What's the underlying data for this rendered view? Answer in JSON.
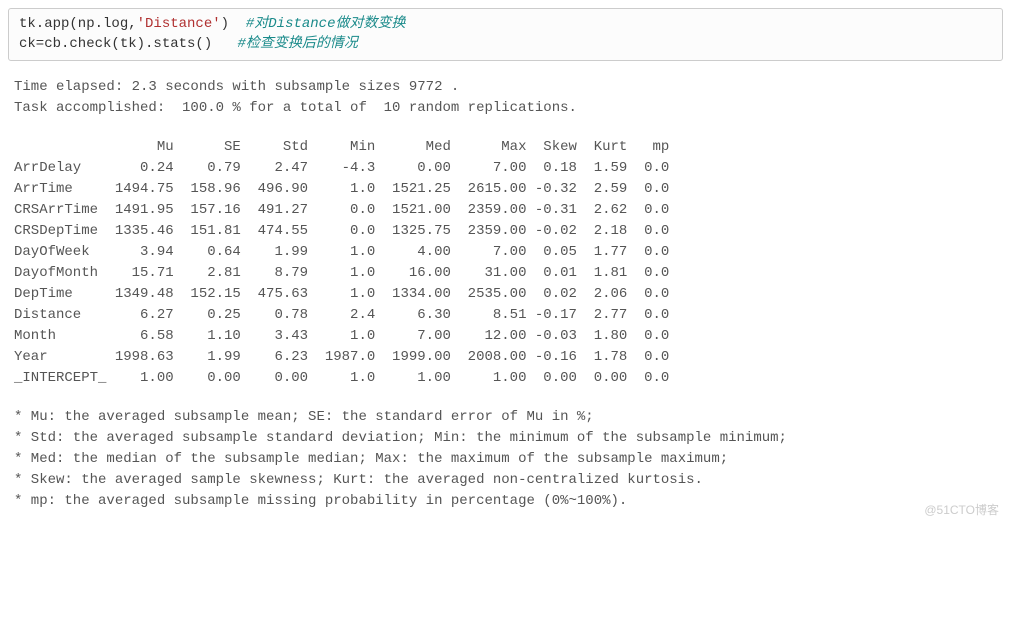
{
  "code": {
    "line1_pre": "tk.app(np.log,",
    "line1_str": "'Distance'",
    "line1_post": ")  ",
    "line1_comment": "#对Distance做对数变换",
    "line2_pre": "ck=cb.check(tk).stats()   ",
    "line2_comment": "#检查变换后的情况"
  },
  "output": {
    "line1": "Time elapsed: 2.3 seconds with subsample sizes 9772 .",
    "line2": "Task accomplished:  100.0 % for a total of  10 random replications."
  },
  "stats": {
    "header": "                 Mu      SE     Std     Min      Med      Max  Skew  Kurt   mp",
    "rows": [
      "ArrDelay       0.24    0.79    2.47    -4.3     0.00     7.00  0.18  1.59  0.0",
      "ArrTime     1494.75  158.96  496.90     1.0  1521.25  2615.00 -0.32  2.59  0.0",
      "CRSArrTime  1491.95  157.16  491.27     0.0  1521.00  2359.00 -0.31  2.62  0.0",
      "CRSDepTime  1335.46  151.81  474.55     0.0  1325.75  2359.00 -0.02  2.18  0.0",
      "DayOfWeek      3.94    0.64    1.99     1.0     4.00     7.00  0.05  1.77  0.0",
      "DayofMonth    15.71    2.81    8.79     1.0    16.00    31.00  0.01  1.81  0.0",
      "DepTime     1349.48  152.15  475.63     1.0  1334.00  2535.00  0.02  2.06  0.0",
      "Distance       6.27    0.25    0.78     2.4     6.30     8.51 -0.17  2.77  0.0",
      "Month          6.58    1.10    3.43     1.0     7.00    12.00 -0.03  1.80  0.0",
      "Year        1998.63    1.99    6.23  1987.0  1999.00  2008.00 -0.16  1.78  0.0",
      "_INTERCEPT_    1.00    0.00    0.00     1.0     1.00     1.00  0.00  0.00  0.0"
    ]
  },
  "chart_data": {
    "type": "table",
    "columns": [
      "Mu",
      "SE",
      "Std",
      "Min",
      "Med",
      "Max",
      "Skew",
      "Kurt",
      "mp"
    ],
    "rows": [
      {
        "name": "ArrDelay",
        "Mu": 0.24,
        "SE": 0.79,
        "Std": 2.47,
        "Min": -4.3,
        "Med": 0.0,
        "Max": 7.0,
        "Skew": 0.18,
        "Kurt": 1.59,
        "mp": 0.0
      },
      {
        "name": "ArrTime",
        "Mu": 1494.75,
        "SE": 158.96,
        "Std": 496.9,
        "Min": 1.0,
        "Med": 1521.25,
        "Max": 2615.0,
        "Skew": -0.32,
        "Kurt": 2.59,
        "mp": 0.0
      },
      {
        "name": "CRSArrTime",
        "Mu": 1491.95,
        "SE": 157.16,
        "Std": 491.27,
        "Min": 0.0,
        "Med": 1521.0,
        "Max": 2359.0,
        "Skew": -0.31,
        "Kurt": 2.62,
        "mp": 0.0
      },
      {
        "name": "CRSDepTime",
        "Mu": 1335.46,
        "SE": 151.81,
        "Std": 474.55,
        "Min": 0.0,
        "Med": 1325.75,
        "Max": 2359.0,
        "Skew": -0.02,
        "Kurt": 2.18,
        "mp": 0.0
      },
      {
        "name": "DayOfWeek",
        "Mu": 3.94,
        "SE": 0.64,
        "Std": 1.99,
        "Min": 1.0,
        "Med": 4.0,
        "Max": 7.0,
        "Skew": 0.05,
        "Kurt": 1.77,
        "mp": 0.0
      },
      {
        "name": "DayofMonth",
        "Mu": 15.71,
        "SE": 2.81,
        "Std": 8.79,
        "Min": 1.0,
        "Med": 16.0,
        "Max": 31.0,
        "Skew": 0.01,
        "Kurt": 1.81,
        "mp": 0.0
      },
      {
        "name": "DepTime",
        "Mu": 1349.48,
        "SE": 152.15,
        "Std": 475.63,
        "Min": 1.0,
        "Med": 1334.0,
        "Max": 2535.0,
        "Skew": 0.02,
        "Kurt": 2.06,
        "mp": 0.0
      },
      {
        "name": "Distance",
        "Mu": 6.27,
        "SE": 0.25,
        "Std": 0.78,
        "Min": 2.4,
        "Med": 6.3,
        "Max": 8.51,
        "Skew": -0.17,
        "Kurt": 2.77,
        "mp": 0.0
      },
      {
        "name": "Month",
        "Mu": 6.58,
        "SE": 1.1,
        "Std": 3.43,
        "Min": 1.0,
        "Med": 7.0,
        "Max": 12.0,
        "Skew": -0.03,
        "Kurt": 1.8,
        "mp": 0.0
      },
      {
        "name": "Year",
        "Mu": 1998.63,
        "SE": 1.99,
        "Std": 6.23,
        "Min": 1987.0,
        "Med": 1999.0,
        "Max": 2008.0,
        "Skew": -0.16,
        "Kurt": 1.78,
        "mp": 0.0
      },
      {
        "name": "_INTERCEPT_",
        "Mu": 1.0,
        "SE": 0.0,
        "Std": 0.0,
        "Min": 1.0,
        "Med": 1.0,
        "Max": 1.0,
        "Skew": 0.0,
        "Kurt": 0.0,
        "mp": 0.0
      }
    ]
  },
  "notes": {
    "n1": "* Mu: the averaged subsample mean; SE: the standard error of Mu in %;",
    "n2": "* Std: the averaged subsample standard deviation; Min: the minimum of the subsample minimum;",
    "n3": "* Med: the median of the subsample median; Max: the maximum of the subsample maximum;",
    "n4": "* Skew: the averaged sample skewness; Kurt: the averaged non-centralized kurtosis.",
    "n5": "* mp: the averaged subsample missing probability in percentage (0%~100%)."
  },
  "watermark": "@51CTO博客"
}
